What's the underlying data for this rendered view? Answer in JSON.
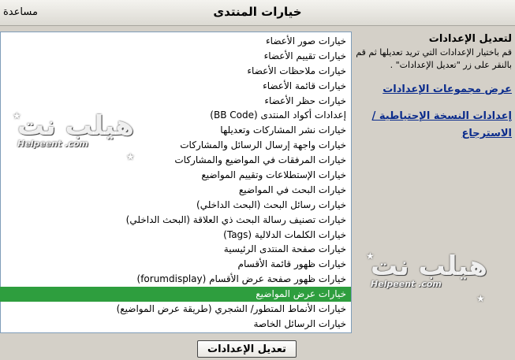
{
  "titlebar": {
    "title": "خيارات المنتدى",
    "help": "مساعدة"
  },
  "options_list": {
    "selected_index": 17,
    "selected_color": "#2e9e3e",
    "items": [
      "خيارات صور الأعضاء",
      "خيارات تقييم الأعضاء",
      "خيارات ملاحظات الأعضاء",
      "خيارات قائمة الأعضاء",
      "خيارات حظر الأعضاء",
      "إعدادات أكواد المنتدى (BB Code)",
      "خيارات نشر المشاركات وتعديلها",
      "خيارات واجهة إرسال الرسائل والمشاركات",
      "خيارات المرفقات في المواضيع والمشاركات",
      "خيارات الإستطلاعات وتقييم المواضيع",
      "خيارات البحث في المواضيع",
      "خيارات رسائل البحث (البحث الداخلي)",
      "خيارات تصنيف رسالة البحث ذي العلاقة (البحث الداخلي)",
      "خيارات الكلمات الدلالية (Tags)",
      "خيارات صفحة المنتدى الرئيسية",
      "خيارات ظهور قائمة الأقسام",
      "خيارات ظهور صفحة عرض الأقسام (forumdisplay)",
      "خيارات عرض المواضيع",
      "خيارات الأنماط المتطور/ الشجري (طريقة عرض المواضيع)",
      "خيارات الرسائل الخاصة"
    ]
  },
  "side_panel": {
    "heading": "لتعديل الإعدادات",
    "description": "قم باختيار الإعدادات التي تريد تعديلها ثم قم بالنقر على زر \"تعديل الإعدادات\" .",
    "link_groups": "عرض مجموعات الإعدادات",
    "link_backup": "إعدادات النسخة الإحتياطية / الاسترجاع"
  },
  "watermark": {
    "logo_text": "هيلب نت",
    "url": "Helpeent .com"
  },
  "save_button": {
    "label": "تعديل الإعدادات"
  }
}
